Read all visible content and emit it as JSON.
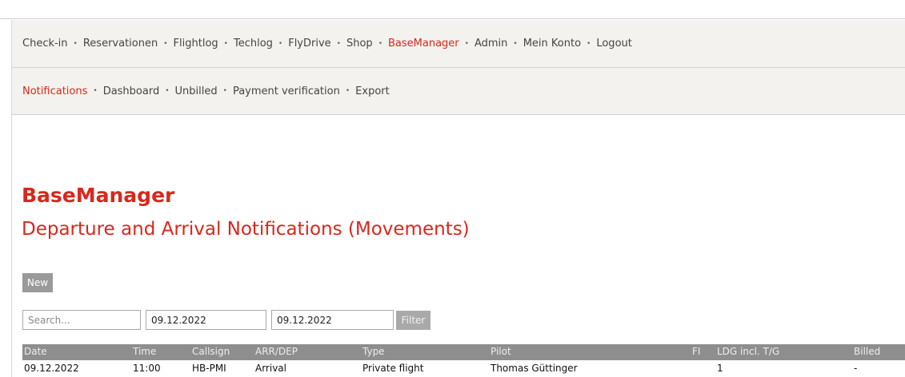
{
  "nav": {
    "items": [
      {
        "label": "Check-in",
        "active": false
      },
      {
        "label": "Reservationen",
        "active": false
      },
      {
        "label": "Flightlog",
        "active": false
      },
      {
        "label": "Techlog",
        "active": false
      },
      {
        "label": "FlyDrive",
        "active": false
      },
      {
        "label": "Shop",
        "active": false
      },
      {
        "label": "BaseManager",
        "active": true
      },
      {
        "label": "Admin",
        "active": false
      },
      {
        "label": "Mein Konto",
        "active": false
      },
      {
        "label": "Logout",
        "active": false
      }
    ]
  },
  "subnav": {
    "items": [
      {
        "label": "Notifications",
        "active": true
      },
      {
        "label": "Dashboard",
        "active": false
      },
      {
        "label": "Unbilled",
        "active": false
      },
      {
        "label": "Payment verification",
        "active": false
      },
      {
        "label": "Export",
        "active": false
      }
    ]
  },
  "page": {
    "title": "BaseManager",
    "subtitle": "Departure and Arrival Notifications (Movements)"
  },
  "toolbar": {
    "new_label": "New",
    "filter_label": "Filter"
  },
  "filters": {
    "search_placeholder": "Search...",
    "date_from": "09.12.2022",
    "date_to": "09.12.2022"
  },
  "table": {
    "headers": {
      "date": "Date",
      "time": "Time",
      "callsign": "Callsign",
      "arr_dep": "ARR/DEP",
      "type": "Type",
      "pilot": "Pilot",
      "fi": "FI",
      "ldg": "LDG incl. T/G",
      "billed": "Billed"
    },
    "rows": [
      {
        "date": "09.12.2022",
        "time": "11:00",
        "callsign": "HB-PMI",
        "arr_dep": "Arrival",
        "type": "Private flight",
        "pilot": "Thomas Güttinger",
        "fi": "",
        "ldg": "1",
        "billed": "-"
      }
    ]
  },
  "colors": {
    "accent": "#d8281c",
    "nav_background": "#f3f2ef",
    "table_header": "#8e8e8e",
    "button_gray": "#9a9a9a"
  }
}
